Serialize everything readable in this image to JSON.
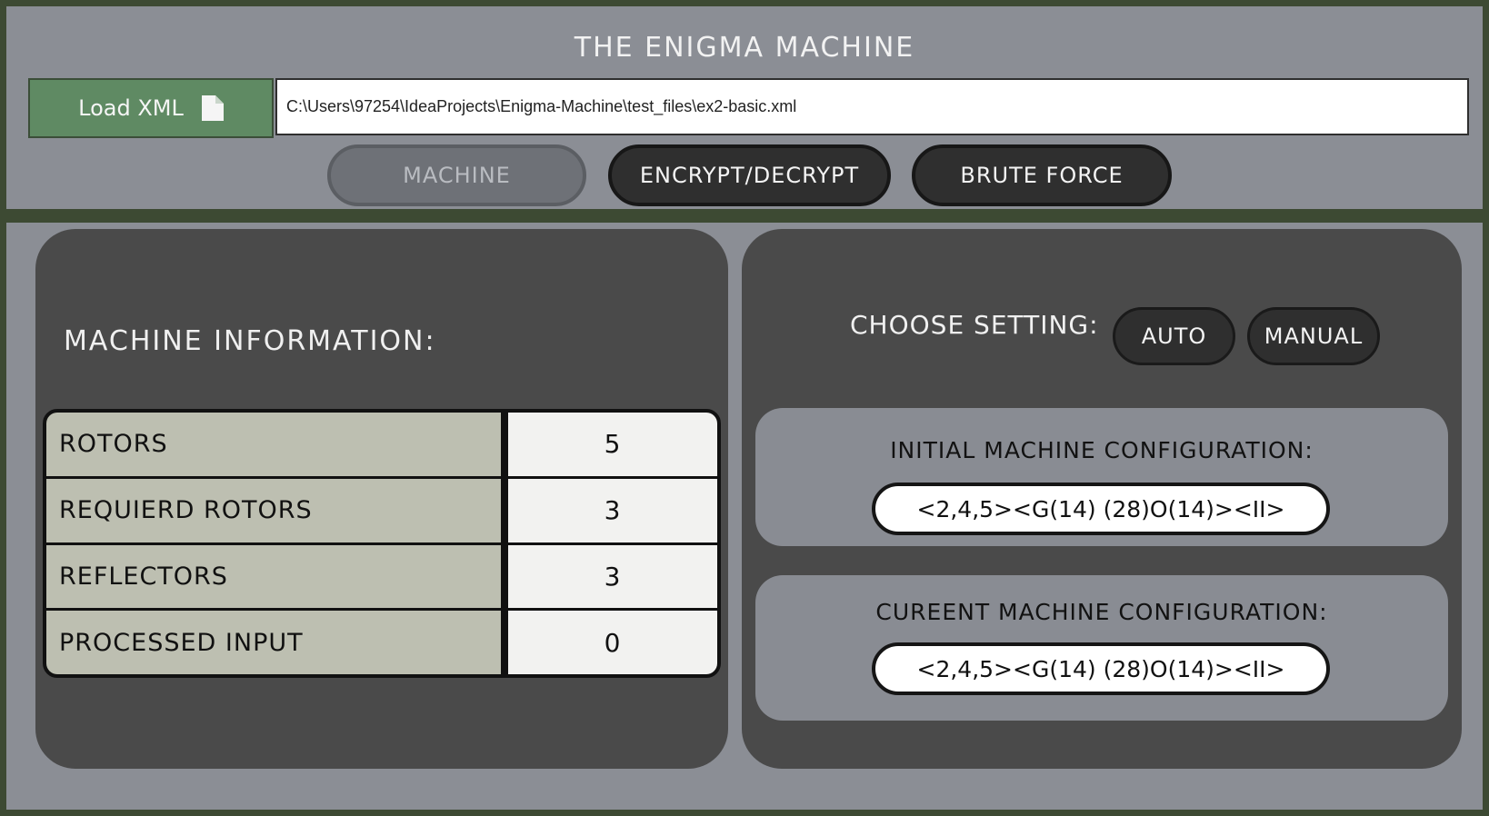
{
  "app": {
    "title": "THE ENIGMA MACHINE"
  },
  "toolbar": {
    "load_label": "Load XML",
    "load_icon": "file-icon",
    "file_path": "C:\\Users\\97254\\IdeaProjects\\Enigma-Machine\\test_files\\ex2-basic.xml"
  },
  "tabs": [
    {
      "label": "MACHINE",
      "active": true
    },
    {
      "label": "ENCRYPT/DECRYPT",
      "active": false
    },
    {
      "label": "BRUTE FORCE",
      "active": false
    }
  ],
  "machine_info": {
    "title": "MACHINE INFORMATION:",
    "rows": [
      {
        "label": "ROTORS",
        "value": "5"
      },
      {
        "label": "REQUIERD ROTORS",
        "value": "3"
      },
      {
        "label": "REFLECTORS",
        "value": "3"
      },
      {
        "label": "PROCESSED INPUT",
        "value": "0"
      }
    ]
  },
  "settings": {
    "choose_label": "CHOOSE SETTING:",
    "auto_label": "AUTO",
    "manual_label": "MANUAL",
    "initial_title": "INITIAL MACHINE CONFIGURATION:",
    "initial_value": "<2,4,5><G(14) (28)O(14)><II>",
    "current_title": "CUREENT MACHINE CONFIGURATION:",
    "current_value": "<2,4,5><G(14) (28)O(14)><II>"
  },
  "colors": {
    "frame": "#3d4a33",
    "panel": "#8b8e95",
    "card": "#4a4a4a",
    "load_button": "#5f8a63",
    "table_label_bg": "#bdbfb1"
  }
}
